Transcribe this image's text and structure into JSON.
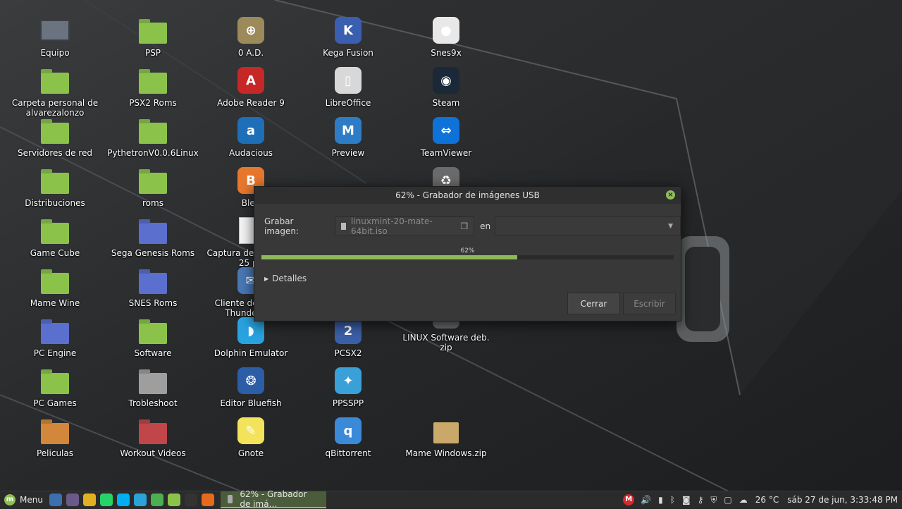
{
  "desktop": {
    "icons": [
      {
        "label": "Equipo",
        "kind": "monitor",
        "color": "#6b7280"
      },
      {
        "label": "Carpeta personal de alvarezalonzo",
        "kind": "folder",
        "color": "#8bc34a"
      },
      {
        "label": "Servidores de red",
        "kind": "folder",
        "color": "#8bc34a"
      },
      {
        "label": "Distribuciones",
        "kind": "folder",
        "color": "#8bc34a"
      },
      {
        "label": "Game Cube",
        "kind": "folder",
        "color": "#8bc34a"
      },
      {
        "label": "Mame Wine",
        "kind": "folder",
        "color": "#8bc34a"
      },
      {
        "label": "PC Engine",
        "kind": "folder",
        "color": "#5b6fcf"
      },
      {
        "label": "PC Games",
        "kind": "folder",
        "color": "#8bc34a"
      },
      {
        "label": "Peliculas",
        "kind": "folder",
        "color": "#d2873a"
      },
      {
        "label": "PSP",
        "kind": "folder",
        "color": "#8bc34a"
      },
      {
        "label": "PSX2 Roms",
        "kind": "folder",
        "color": "#8bc34a"
      },
      {
        "label": "PythetronV0.0.6Linux",
        "kind": "folder",
        "color": "#8bc34a"
      },
      {
        "label": "roms",
        "kind": "folder",
        "color": "#8bc34a"
      },
      {
        "label": "Sega Genesis Roms",
        "kind": "folder",
        "color": "#5b6fcf"
      },
      {
        "label": "SNES Roms",
        "kind": "folder",
        "color": "#5b6fcf"
      },
      {
        "label": "Software",
        "kind": "folder",
        "color": "#8bc34a"
      },
      {
        "label": "Trobleshoot",
        "kind": "folder",
        "color": "#9e9e9e"
      },
      {
        "label": "Workout Videos",
        "kind": "folder",
        "color": "#c0464a"
      },
      {
        "label": "0 A.D.",
        "kind": "app",
        "color": "#9c8a5a",
        "glyph": "⊕"
      },
      {
        "label": "Adobe Reader 9",
        "kind": "app",
        "color": "#c62828",
        "glyph": "A"
      },
      {
        "label": "Audacious",
        "kind": "app",
        "color": "#1e6fb8",
        "glyph": "a"
      },
      {
        "label": "Blen",
        "kind": "app",
        "color": "#e8772e",
        "glyph": "B"
      },
      {
        "label": "Captura de 2020-04-25 pn",
        "kind": "file",
        "color": "#f5f5f5",
        "glyph": ""
      },
      {
        "label": "Cliente de correo Thunderbird",
        "kind": "app",
        "color": "#4a78b5",
        "glyph": "✉"
      },
      {
        "label": "Dolphin Emulator",
        "kind": "app",
        "color": "#29a3e0",
        "glyph": "◗"
      },
      {
        "label": "Editor Bluefish",
        "kind": "app",
        "color": "#2c5ea8",
        "glyph": "❂"
      },
      {
        "label": "Gnote",
        "kind": "app",
        "color": "#f2e35a",
        "glyph": "✎"
      },
      {
        "label": "Kega Fusion",
        "kind": "app",
        "color": "#3a5fb0",
        "glyph": "K"
      },
      {
        "label": "LibreOffice",
        "kind": "app",
        "color": "#d8d8d8",
        "glyph": "▯"
      },
      {
        "label": "Preview",
        "kind": "app",
        "color": "#2f7cc6",
        "glyph": "M"
      },
      {
        "label": "PCSX2",
        "kind": "app",
        "color": "#3b5fa8",
        "glyph": "2"
      },
      {
        "label": "PPSSPP",
        "kind": "app",
        "color": "#3aa0d8",
        "glyph": "✦"
      },
      {
        "label": "qBittorrent",
        "kind": "app",
        "color": "#3a8ad8",
        "glyph": "q"
      },
      {
        "label": "Snes9x",
        "kind": "app",
        "color": "#e8e8e8",
        "glyph": "●"
      },
      {
        "label": "Steam",
        "kind": "app",
        "color": "#1b2838",
        "glyph": "◉"
      },
      {
        "label": "TeamViewer",
        "kind": "app",
        "color": "#0e72d8",
        "glyph": "⇔"
      },
      {
        "label": "",
        "kind": "app",
        "color": "#6b6b6b",
        "glyph": "♻"
      },
      {
        "label": "LINUX Software deb. zip",
        "kind": "app",
        "color": "#6b6b6b",
        "glyph": ""
      },
      {
        "label": "Mame Windows.zip",
        "kind": "archive",
        "color": "#c9a86a",
        "glyph": ""
      }
    ]
  },
  "dialog": {
    "title": "62% - Grabador de imágenes USB",
    "image_label": "Grabar imagen:",
    "image_value": "linuxmint-20-mate-64bit.iso",
    "target_label": "en",
    "target_value": "",
    "progress_text": "62%",
    "progress": 0.62,
    "details_label": "Detalles",
    "close_label": "Cerrar",
    "write_label": "Escribir"
  },
  "taskbar": {
    "menu_label": "Menu",
    "launchers": [
      {
        "name": "show-desktop",
        "color": "#3b6fb0"
      },
      {
        "name": "screenshot",
        "color": "#6a5a8a"
      },
      {
        "name": "chrome",
        "color": "#e0b020"
      },
      {
        "name": "whatsapp",
        "color": "#25d366"
      },
      {
        "name": "skype",
        "color": "#00aff0"
      },
      {
        "name": "telegram",
        "color": "#2aa3d8"
      },
      {
        "name": "spreadsheet",
        "color": "#4caf50"
      },
      {
        "name": "files",
        "color": "#8bc34a"
      },
      {
        "name": "terminal",
        "color": "#333333"
      },
      {
        "name": "firefox",
        "color": "#e66a1c"
      }
    ],
    "task_label": "62% - Grabador de imá…",
    "weather": "26 °C",
    "clock": "sáb 27 de jun, 3:33:48 PM"
  }
}
